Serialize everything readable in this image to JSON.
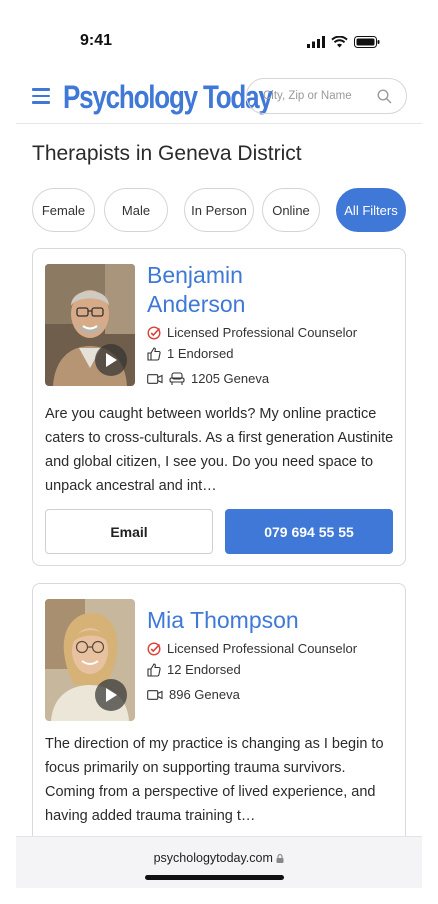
{
  "status_bar": {
    "time": "9:41"
  },
  "header": {
    "logo": "Psychology Today",
    "search_placeholder": "City, Zip or Name"
  },
  "page_title": "Therapists in Geneva District",
  "filters": [
    "Female",
    "Male",
    "In Person",
    "Online",
    "All Filters"
  ],
  "therapists": [
    {
      "name_line1": "Benjamin",
      "name_line2": "Anderson",
      "title": "Licensed Professional Counselor",
      "endorsed": "1 Endorsed",
      "location": "1205 Geneva",
      "description": "Are you caught between worlds? My online practice caters to cross-culturals. As a first generation Austinite and global citizen, I see you. Do you need space to unpack ancestral and int…",
      "email_label": "Email",
      "phone": "079 694 55 55"
    },
    {
      "name": "Mia Thompson",
      "title": "Licensed Professional Counselor",
      "endorsed": "12 Endorsed",
      "location": "896 Geneva",
      "description": "The direction of my practice is changing as I begin to focus primarily on supporting trauma survivors. Coming from a perspective of lived experience, and having added trauma training t…"
    }
  ],
  "browser": {
    "url": "psychologytoday.com"
  },
  "colors": {
    "brand_blue": "#3f78d6",
    "check_red": "#d9443a"
  }
}
